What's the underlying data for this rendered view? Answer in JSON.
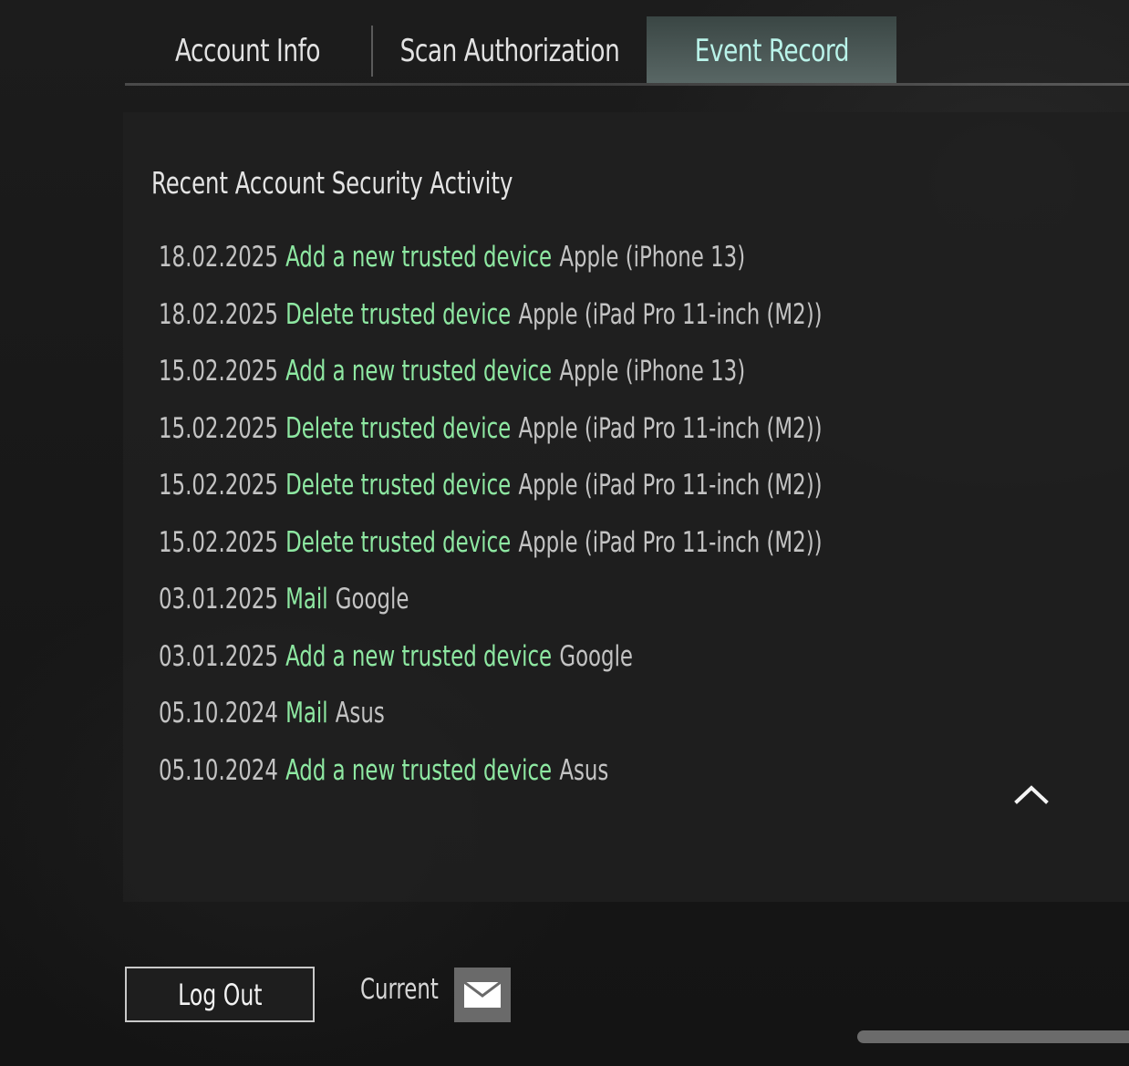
{
  "tabs": [
    {
      "label": "Account Info",
      "active": false
    },
    {
      "label": "Scan Authorization",
      "active": false
    },
    {
      "label": "Event Record",
      "active": true
    }
  ],
  "panel": {
    "title": "Recent Account Security Activity",
    "events": [
      {
        "date": "18.02.2025",
        "action": "Add a new trusted device",
        "device": "Apple (iPhone 13)"
      },
      {
        "date": "18.02.2025",
        "action": "Delete trusted device",
        "device": "Apple (iPad Pro 11-inch  (M2))"
      },
      {
        "date": "15.02.2025",
        "action": "Add a new trusted device",
        "device": "Apple (iPhone 13)"
      },
      {
        "date": "15.02.2025",
        "action": "Delete trusted device",
        "device": "Apple (iPad Pro 11-inch  (M2))"
      },
      {
        "date": "15.02.2025",
        "action": "Delete trusted device",
        "device": "Apple (iPad Pro 11-inch  (M2))"
      },
      {
        "date": "15.02.2025",
        "action": "Delete trusted device",
        "device": "Apple (iPad Pro 11-inch  (M2))"
      },
      {
        "date": "03.01.2025",
        "action": "Mail",
        "device": "Google"
      },
      {
        "date": "03.01.2025",
        "action": "Add a new trusted device",
        "device": "Google"
      },
      {
        "date": "05.10.2024",
        "action": "Mail",
        "device": "Asus"
      },
      {
        "date": "05.10.2024",
        "action": "Add a new trusted device",
        "device": "Asus"
      }
    ],
    "scroll_icon": "chevron-up-icon"
  },
  "footer": {
    "logout_label": "Log Out",
    "current_label": "Current",
    "mail_icon": "envelope-icon"
  },
  "colors": {
    "action_green": "#8ee8a2",
    "active_tab_text": "#b9f3e9",
    "text_gray": "#c3c3c3"
  }
}
